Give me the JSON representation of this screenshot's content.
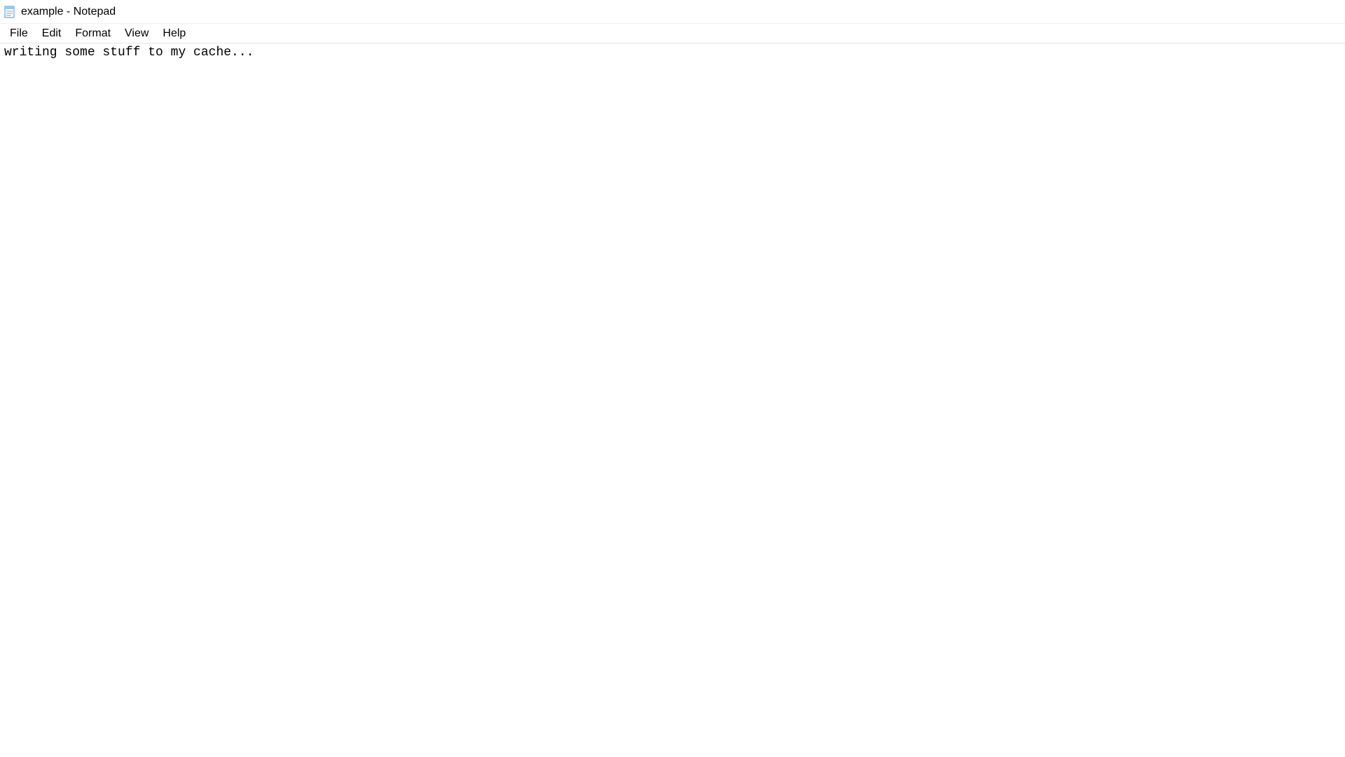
{
  "window": {
    "title": "example - Notepad"
  },
  "menu": {
    "file": "File",
    "edit": "Edit",
    "format": "Format",
    "view": "View",
    "help": "Help"
  },
  "editor": {
    "content": "writing some stuff to my cache..."
  }
}
